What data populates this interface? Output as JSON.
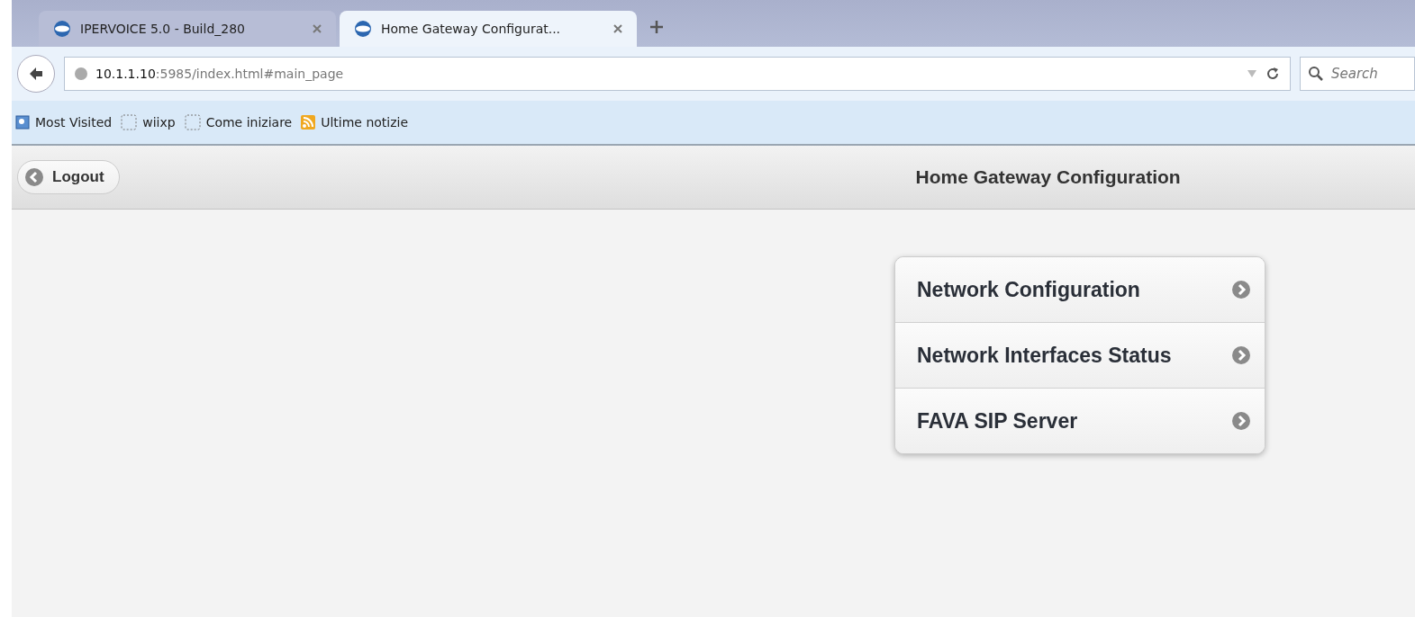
{
  "tabs": [
    {
      "label": "IPERVOICE 5.0 - Build_280",
      "selected": false
    },
    {
      "label": "Home Gateway Configurat...",
      "selected": true
    }
  ],
  "address": {
    "host": "10.1.1.10",
    "path": ":5985/index.html#main_page"
  },
  "search": {
    "placeholder": "Search"
  },
  "bookmarks": [
    {
      "label": "Most Visited",
      "kind": "special"
    },
    {
      "label": "wiixp",
      "kind": "page"
    },
    {
      "label": "Come iniziare",
      "kind": "page"
    },
    {
      "label": "Ultime notizie",
      "kind": "feed"
    }
  ],
  "header": {
    "back_button": "Logout",
    "title": "Home Gateway Configuration"
  },
  "menu": [
    {
      "label": "Network Configuration"
    },
    {
      "label": "Network Interfaces Status"
    },
    {
      "label": "FAVA SIP Server"
    }
  ]
}
